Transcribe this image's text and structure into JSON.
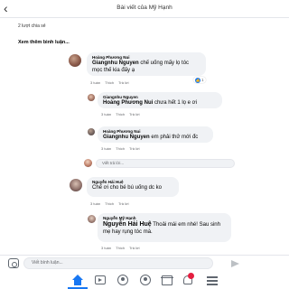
{
  "header": {
    "back_glyph": "‹",
    "title": "Bài viết của Mỹ Hạnh"
  },
  "post": {
    "shares": "2 lượt chia sẻ",
    "see_more": "Xem thêm bình luận..."
  },
  "comments": [
    {
      "name": "Hoàng Phương Nui",
      "tag": "Giangnhu Nguyen",
      "text": " chế uống mấy lọ tóc mọc thế kia đấy ạ",
      "time": "3 tuần",
      "like": "Thích",
      "reply": "Trả lời",
      "reaction_count": "1"
    },
    {
      "name": "Giangnhu Nguyen",
      "tag": "Hoàng Phương Nui",
      "text": " chưa hết 1 lọ e ơi",
      "time": "3 tuần",
      "like": "Thích",
      "reply": "Trả lời"
    },
    {
      "name": "Hoàng Phương Nui",
      "tag": "Giangnhu Nguyen",
      "text": " em phải thử mới đc",
      "time": "3 tuần",
      "like": "Thích",
      "reply": "Trả lời"
    },
    {
      "name": "Nguyễn Hải Huệ",
      "text": "Chế ơi cho bé bú uống dc ko",
      "time": "3 tuần",
      "like": "Thích",
      "reply": "Trả lời"
    },
    {
      "name": "Nguyễn Mỹ Hạnh",
      "tag": "Nguyễn Hải Huệ",
      "text": " Thoải mái em nhé! Sau sinh mẹ hay rụng tóc mà.",
      "time": "3 tuần",
      "like": "Thích",
      "reply": "Trả lời"
    }
  ],
  "reply_placeholder": "Viết trả lời...",
  "composer": {
    "placeholder": "Viết bình luận..."
  },
  "icons": [
    "back-icon",
    "camera-icon",
    "send-icon",
    "home-icon",
    "watch-icon",
    "groups-icon",
    "profile-icon",
    "marketplace-icon",
    "notifications-icon",
    "menu-icon"
  ],
  "colors": {
    "accent": "#1877f2",
    "badge": "#e41e3f",
    "bubble": "#f0f2f5"
  }
}
